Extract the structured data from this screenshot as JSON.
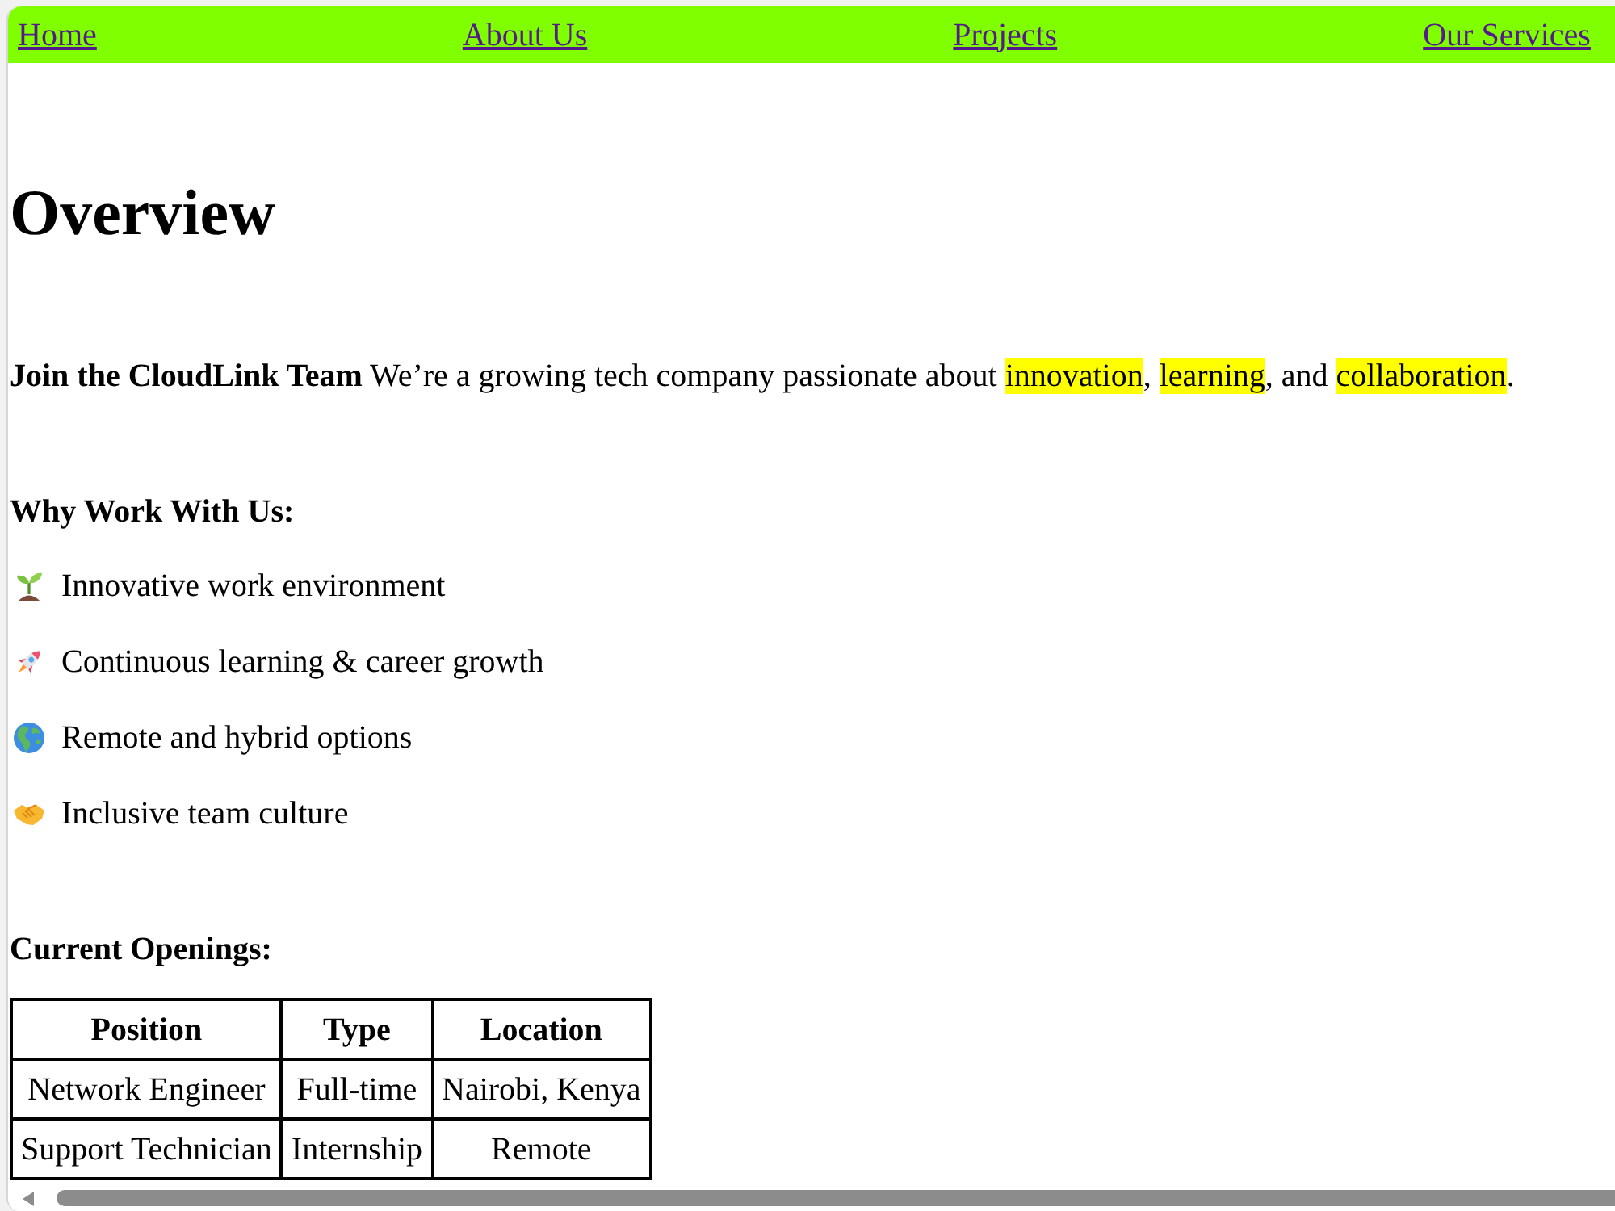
{
  "nav": {
    "links": [
      "Home",
      "About Us",
      "Projects",
      "Our Services"
    ]
  },
  "heading": "Overview",
  "intro": {
    "segments": [
      {
        "kind": "strong",
        "text": "Join the CloudLink Team"
      },
      {
        "kind": "text",
        "text": " We’re a growing tech company passionate about "
      },
      {
        "kind": "mark",
        "text": "innovation"
      },
      {
        "kind": "text",
        "text": ", "
      },
      {
        "kind": "mark",
        "text": "learning"
      },
      {
        "kind": "text",
        "text": ", and "
      },
      {
        "kind": "mark",
        "text": "collaboration"
      },
      {
        "kind": "text",
        "text": "."
      }
    ]
  },
  "benefits": {
    "title": "Why Work With Us:",
    "items": [
      {
        "kind": "seedling",
        "text": "Innovative work environment"
      },
      {
        "kind": "rocket",
        "text": "Continuous learning & career growth"
      },
      {
        "kind": "globe",
        "text": "Remote and hybrid options"
      },
      {
        "kind": "handshake",
        "text": "Inclusive team culture"
      }
    ]
  },
  "openings": {
    "title": "Current Openings:",
    "table": {
      "columns": [
        "Position",
        "Type",
        "Location"
      ],
      "rows": [
        [
          "Network Engineer",
          "Full-time",
          "Nairobi, Kenya"
        ],
        [
          "Support Technician",
          "Internship",
          "Remote"
        ]
      ]
    }
  }
}
